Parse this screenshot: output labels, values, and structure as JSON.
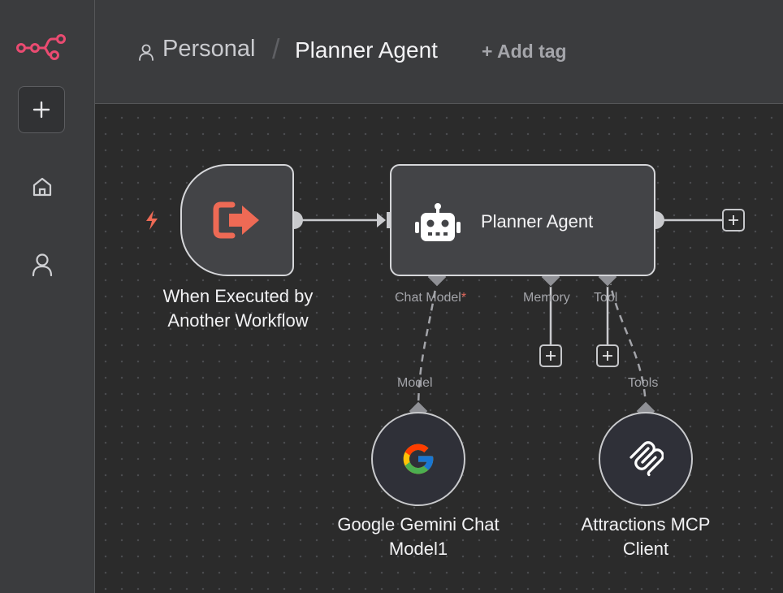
{
  "header": {
    "breadcrumb": {
      "project": "Personal",
      "separator": "/",
      "workflow": "Planner Agent"
    },
    "add_tag": "+ Add tag"
  },
  "nodes": {
    "trigger": {
      "title_line1": "When Executed by",
      "title_line2": "Another Workflow",
      "icon": "exit-arrow-icon"
    },
    "agent": {
      "label": "Planner Agent",
      "icon": "robot-icon"
    },
    "gemini": {
      "title_line1": "Google Gemini Chat",
      "title_line2": "Model1",
      "icon": "google-g-icon"
    },
    "mcp": {
      "title_line1": "Attractions MCP",
      "title_line2": "Client",
      "icon": "mcp-icon"
    }
  },
  "handles": {
    "chat_model": "Chat Model",
    "chat_model_required": "*",
    "memory": "Memory",
    "tool": "Tool",
    "model": "Model",
    "tools": "Tools"
  },
  "colors": {
    "accent": "#ea4b71",
    "trigger_icon": "#ee6a55",
    "node_border": "#d6d7da",
    "node_fill": "#434447",
    "canvas": "#2b2b2b"
  }
}
